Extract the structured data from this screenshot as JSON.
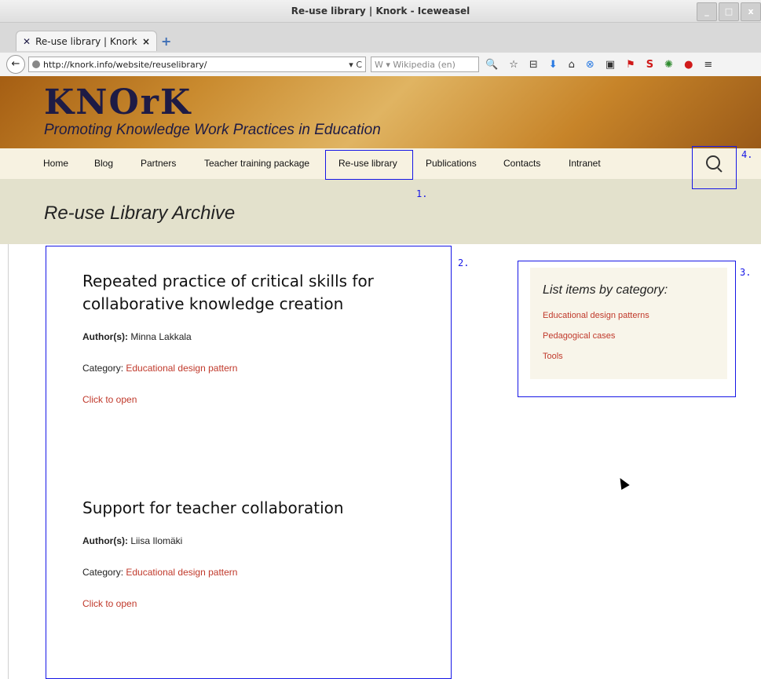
{
  "window": {
    "title": "Re-use library | Knork - Iceweasel",
    "buttons": [
      "_",
      "□",
      "x"
    ]
  },
  "tab": {
    "label": "Re-use library | Knork",
    "close": "×",
    "new_tab": "+"
  },
  "navbar": {
    "back": "←",
    "url": "http://knork.info/website/reuselibrary/",
    "url_controls": "▾ C",
    "search_placeholder": "W ▾ Wikipedia (en)",
    "toolbar_icons": [
      "search-icon",
      "star-icon",
      "bookmarks-icon",
      "download-icon",
      "home-icon",
      "addon-icon",
      "addon-icon",
      "flag-icon",
      "addon-icon",
      "addon-icon",
      "addon-icon",
      "menu-icon"
    ],
    "toolbar_glyphs": [
      "🔍",
      "☆",
      "⊟",
      "⬇",
      "⌂",
      "⊗",
      "▣",
      "⚑",
      "S",
      "✺",
      "●",
      "≡"
    ]
  },
  "site": {
    "logo": "KNOrK",
    "tagline": "Promoting Knowledge Work Practices in Education",
    "nav": [
      "Home",
      "Blog",
      "Partners",
      "Teacher training package",
      "Re-use library",
      "Publications",
      "Contacts",
      "Intranet"
    ],
    "archive_title": "Re-use Library Archive"
  },
  "posts": [
    {
      "title": "Repeated practice of critical skills for collaborative knowledge creation",
      "author_label": "Author(s):",
      "author": "Minna Lakkala",
      "category_label": "Category:",
      "category": "Educational design pattern",
      "open": "Click to open"
    },
    {
      "title": "Support for teacher collaboration",
      "author_label": "Author(s):",
      "author": "Liisa Ilomäki",
      "category_label": "Category:",
      "category": "Educational design pattern",
      "open": "Click to open"
    }
  ],
  "sidebar": {
    "heading": "List items by category:",
    "categories": [
      "Educational design patterns",
      "Pedagogical cases",
      "Tools"
    ]
  },
  "annotations": [
    "1.",
    "2.",
    "3.",
    "4."
  ],
  "colors": {
    "link": "#c0392b",
    "annotation": "#1616e6",
    "nav_bg": "#f7f2e1",
    "band_bg": "#e3e1cc"
  }
}
